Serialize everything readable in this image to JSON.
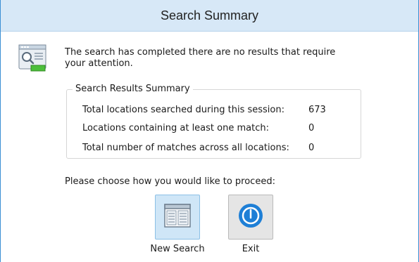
{
  "window": {
    "title": "Search Summary"
  },
  "icons": {
    "info": "search-document-icon",
    "new_search": "document-window-icon",
    "exit": "power-icon"
  },
  "colors": {
    "accent": "#3b8fd4",
    "titlebar": "#d7e8f7",
    "new_search_tile": "#cfe6f7",
    "exit_blue": "#1e7fd6"
  },
  "message": {
    "line1": "The search has completed there are no results that require",
    "line2": "your attention."
  },
  "summary": {
    "legend": "Search Results Summary",
    "rows": [
      {
        "label": "Total locations searched during this session:",
        "value": "673"
      },
      {
        "label": "Locations containing at least one match:",
        "value": "0"
      },
      {
        "label": "Total number of matches across all locations:",
        "value": "0"
      }
    ]
  },
  "prompt": "Please choose how you would like to proceed:",
  "actions": {
    "new_search_label": "New Search",
    "exit_label": "Exit"
  }
}
